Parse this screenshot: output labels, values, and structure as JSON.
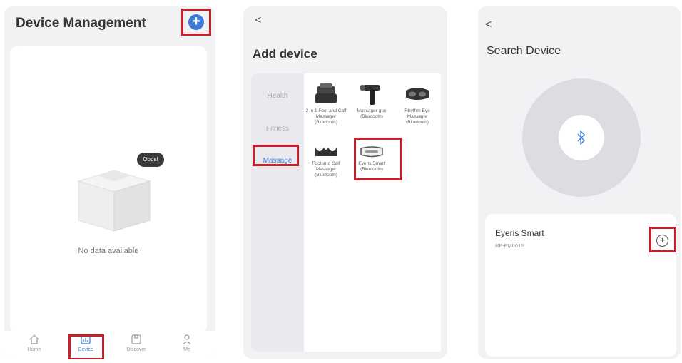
{
  "panel1": {
    "title": "Device Management",
    "oops": "Oops!",
    "empty_text": "No data available",
    "tabs": [
      {
        "label": "Home",
        "icon": "home-icon"
      },
      {
        "label": "Device",
        "icon": "device-icon",
        "active": true
      },
      {
        "label": "Discover",
        "icon": "discover-icon"
      },
      {
        "label": "Me",
        "icon": "user-icon"
      }
    ]
  },
  "panel2": {
    "back": "<",
    "title": "Add device",
    "categories": [
      "Health",
      "Fitness",
      "Massage"
    ],
    "selected_category": "Massage",
    "devices": [
      {
        "name": "2 in 1 Foot and Calf Massager (Bluetooth)",
        "icon": "foot-calf-massager-icon"
      },
      {
        "name": "Massager gun (Bluetooth)",
        "icon": "massager-gun-icon"
      },
      {
        "name": "Rhythm Eye Massager (Bluetooth)",
        "icon": "eye-massager-icon"
      },
      {
        "name": "Foot and Calf Massager (Bluetooth)",
        "icon": "foot-massager-icon"
      },
      {
        "name": "Eyeris Smart (Bluetooth)",
        "icon": "eyeris-smart-icon"
      }
    ]
  },
  "panel3": {
    "back": "<",
    "title": "Search Device",
    "found_device": {
      "name": "Eyeris Smart",
      "id": "RF-EM001S"
    }
  },
  "colors": {
    "accent": "#3d7bd6",
    "highlight": "#c8202a",
    "background": "#f2f2f4"
  }
}
